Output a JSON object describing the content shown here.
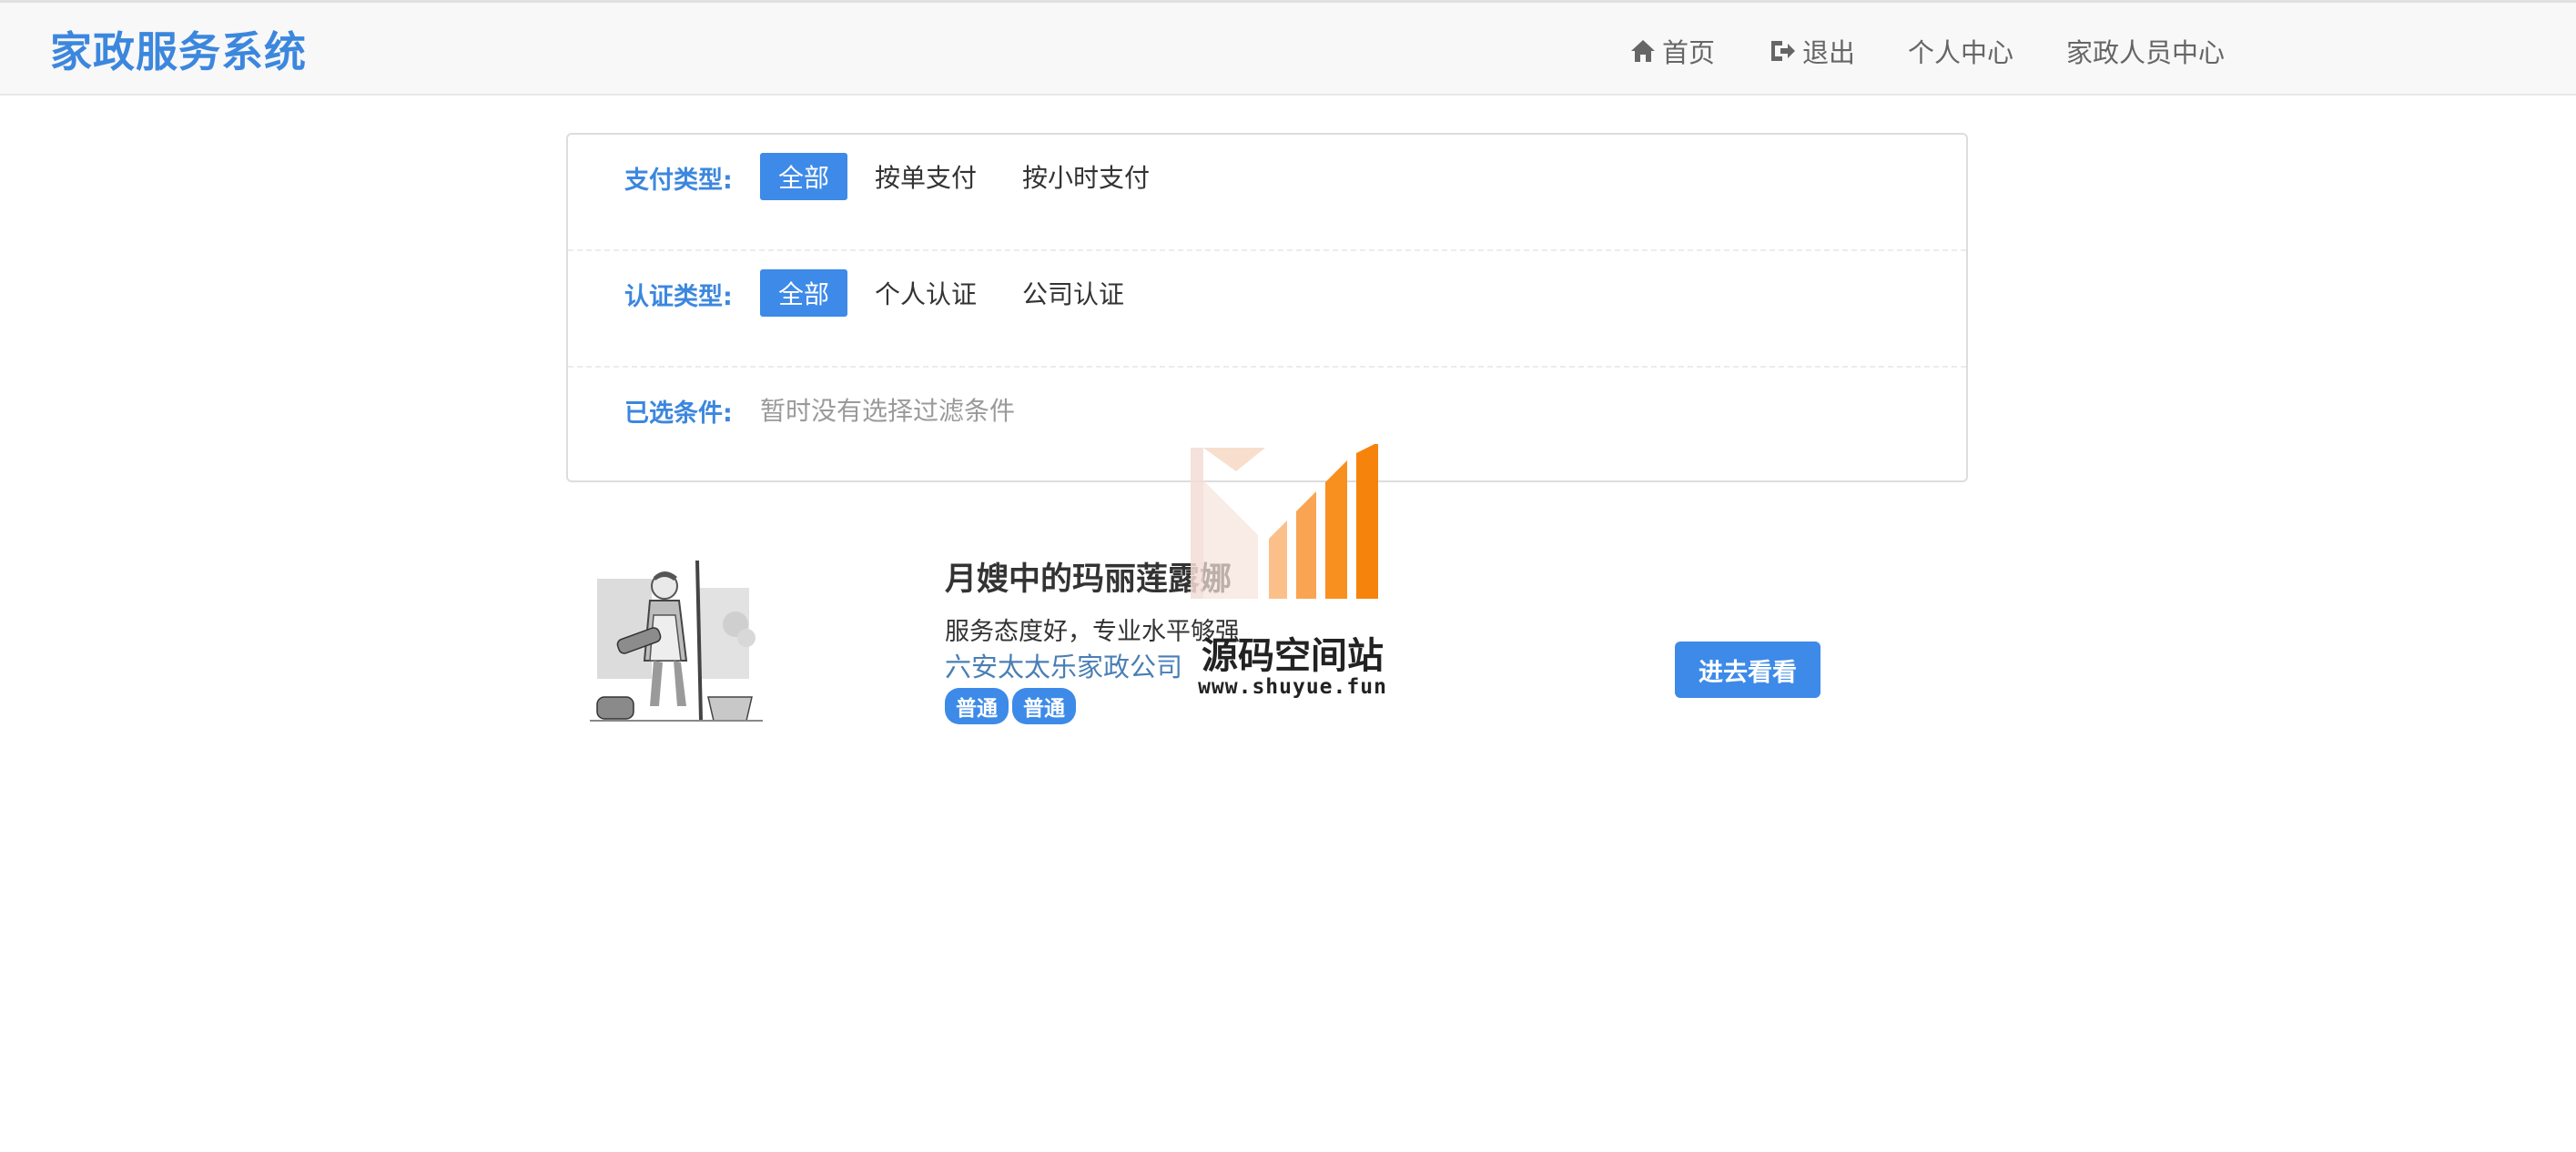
{
  "app": {
    "brand": "家政服务系统"
  },
  "nav": {
    "items": [
      {
        "label": "首页",
        "icon": "home-icon"
      },
      {
        "label": "退出",
        "icon": "sign-out-icon"
      },
      {
        "label": "个人中心"
      },
      {
        "label": "家政人员中心"
      }
    ]
  },
  "filters": {
    "pay_type": {
      "label": "支付类型:",
      "options": [
        "全部",
        "按单支付",
        "按小时支付"
      ],
      "selected": "全部"
    },
    "cert_type": {
      "label": "认证类型:",
      "options": [
        "全部",
        "个人认证",
        "公司认证"
      ],
      "selected": "全部"
    },
    "selected_conditions": {
      "label": "已选条件:",
      "empty_text": "暂时没有选择过滤条件"
    }
  },
  "listings": [
    {
      "title": "月嫂中的玛丽莲露娜",
      "description": "服务态度好，专业水平够强",
      "company": "六安太太乐家政公司",
      "tags": [
        "普通",
        "普通"
      ],
      "button": "进去看看"
    }
  ],
  "watermark": {
    "title": "源码空间站",
    "url": "www.shuyue.fun"
  },
  "colors": {
    "brand": "#3c87de",
    "accent": "#3d8ae8",
    "company_link": "#4a7fb5",
    "hint": "#9a9a9a"
  }
}
